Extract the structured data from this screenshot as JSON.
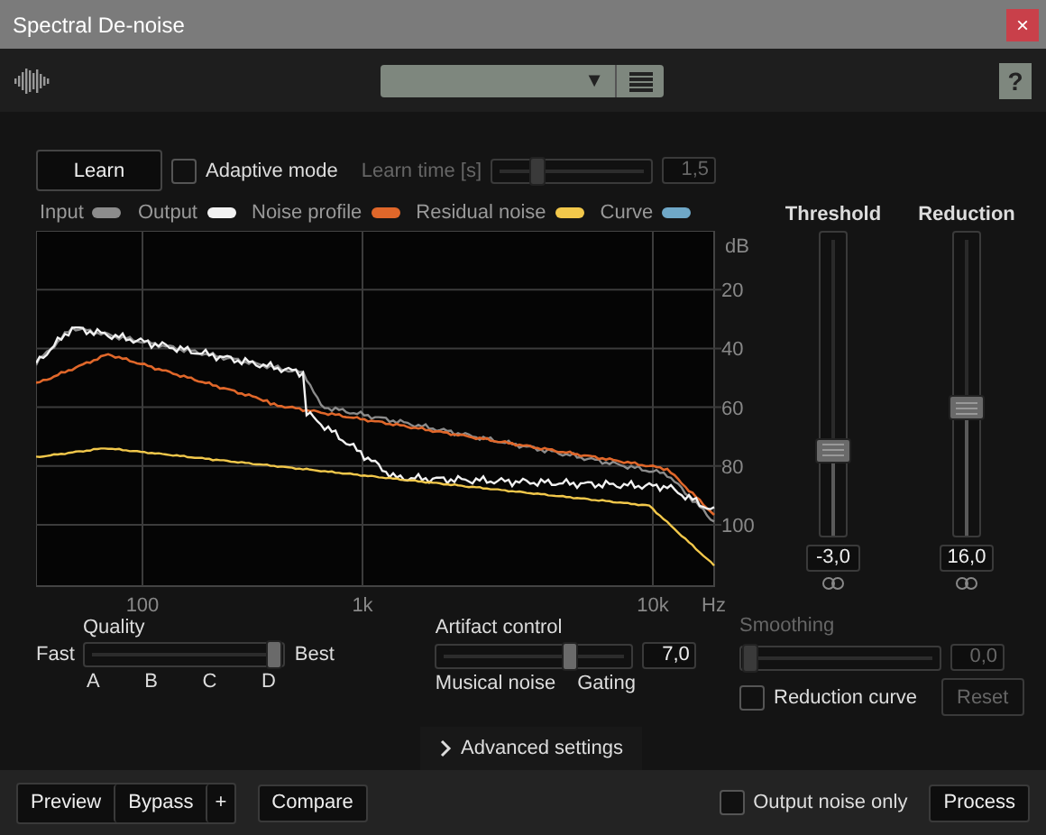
{
  "window": {
    "title": "Spectral De-noise",
    "close": "×"
  },
  "toolbar": {
    "preset_arrow": "▼",
    "help": "?"
  },
  "learn": {
    "button": "Learn",
    "adaptive_mode": {
      "label": "Adaptive mode",
      "checked": false
    },
    "learn_time": {
      "label": "Learn time [s]",
      "level": 0.25,
      "value": "1,5",
      "disabled": true
    }
  },
  "legend": [
    {
      "label": "Input",
      "color": "#8c8c8c"
    },
    {
      "label": "Output",
      "color": "#f2f2f2"
    },
    {
      "label": "Noise profile",
      "color": "#e0672a"
    },
    {
      "label": "Residual noise",
      "color": "#f2c84b"
    },
    {
      "label": "Curve",
      "color": "#6fa8c8"
    }
  ],
  "spectrum": {
    "y_unit": "dB",
    "y_ticks": [
      "20",
      "40",
      "60",
      "80",
      "100"
    ],
    "x_ticks": [
      "100",
      "1k",
      "10k"
    ],
    "x_unit": "Hz"
  },
  "faders": [
    {
      "label": "Threshold",
      "level": 0.28,
      "value": "-3,0"
    },
    {
      "label": "Reduction",
      "level": 0.42,
      "value": "16,0"
    }
  ],
  "quality": {
    "label": "Quality",
    "min_label": "Fast",
    "max_label": "Best",
    "level": 1,
    "steps": [
      "A",
      "B",
      "C",
      "D"
    ]
  },
  "artifact_control": {
    "label": "Artifact control",
    "level": 0.7,
    "value": "7,0",
    "left_label": "Musical noise",
    "right_label": "Gating"
  },
  "smoothing": {
    "label": "Smoothing",
    "level": 0,
    "value": "0,0",
    "disabled": true
  },
  "reduction_curve": {
    "label": "Reduction curve",
    "checked": false
  },
  "reset": {
    "label": "Reset",
    "disabled": true
  },
  "advanced": {
    "label": "Advanced settings",
    "expanded": false
  },
  "footer": {
    "preview": "Preview",
    "bypass": "Bypass",
    "plus": "+",
    "compare": "Compare",
    "output_noise_only": {
      "label": "Output noise only",
      "checked": false
    },
    "process": "Process"
  }
}
